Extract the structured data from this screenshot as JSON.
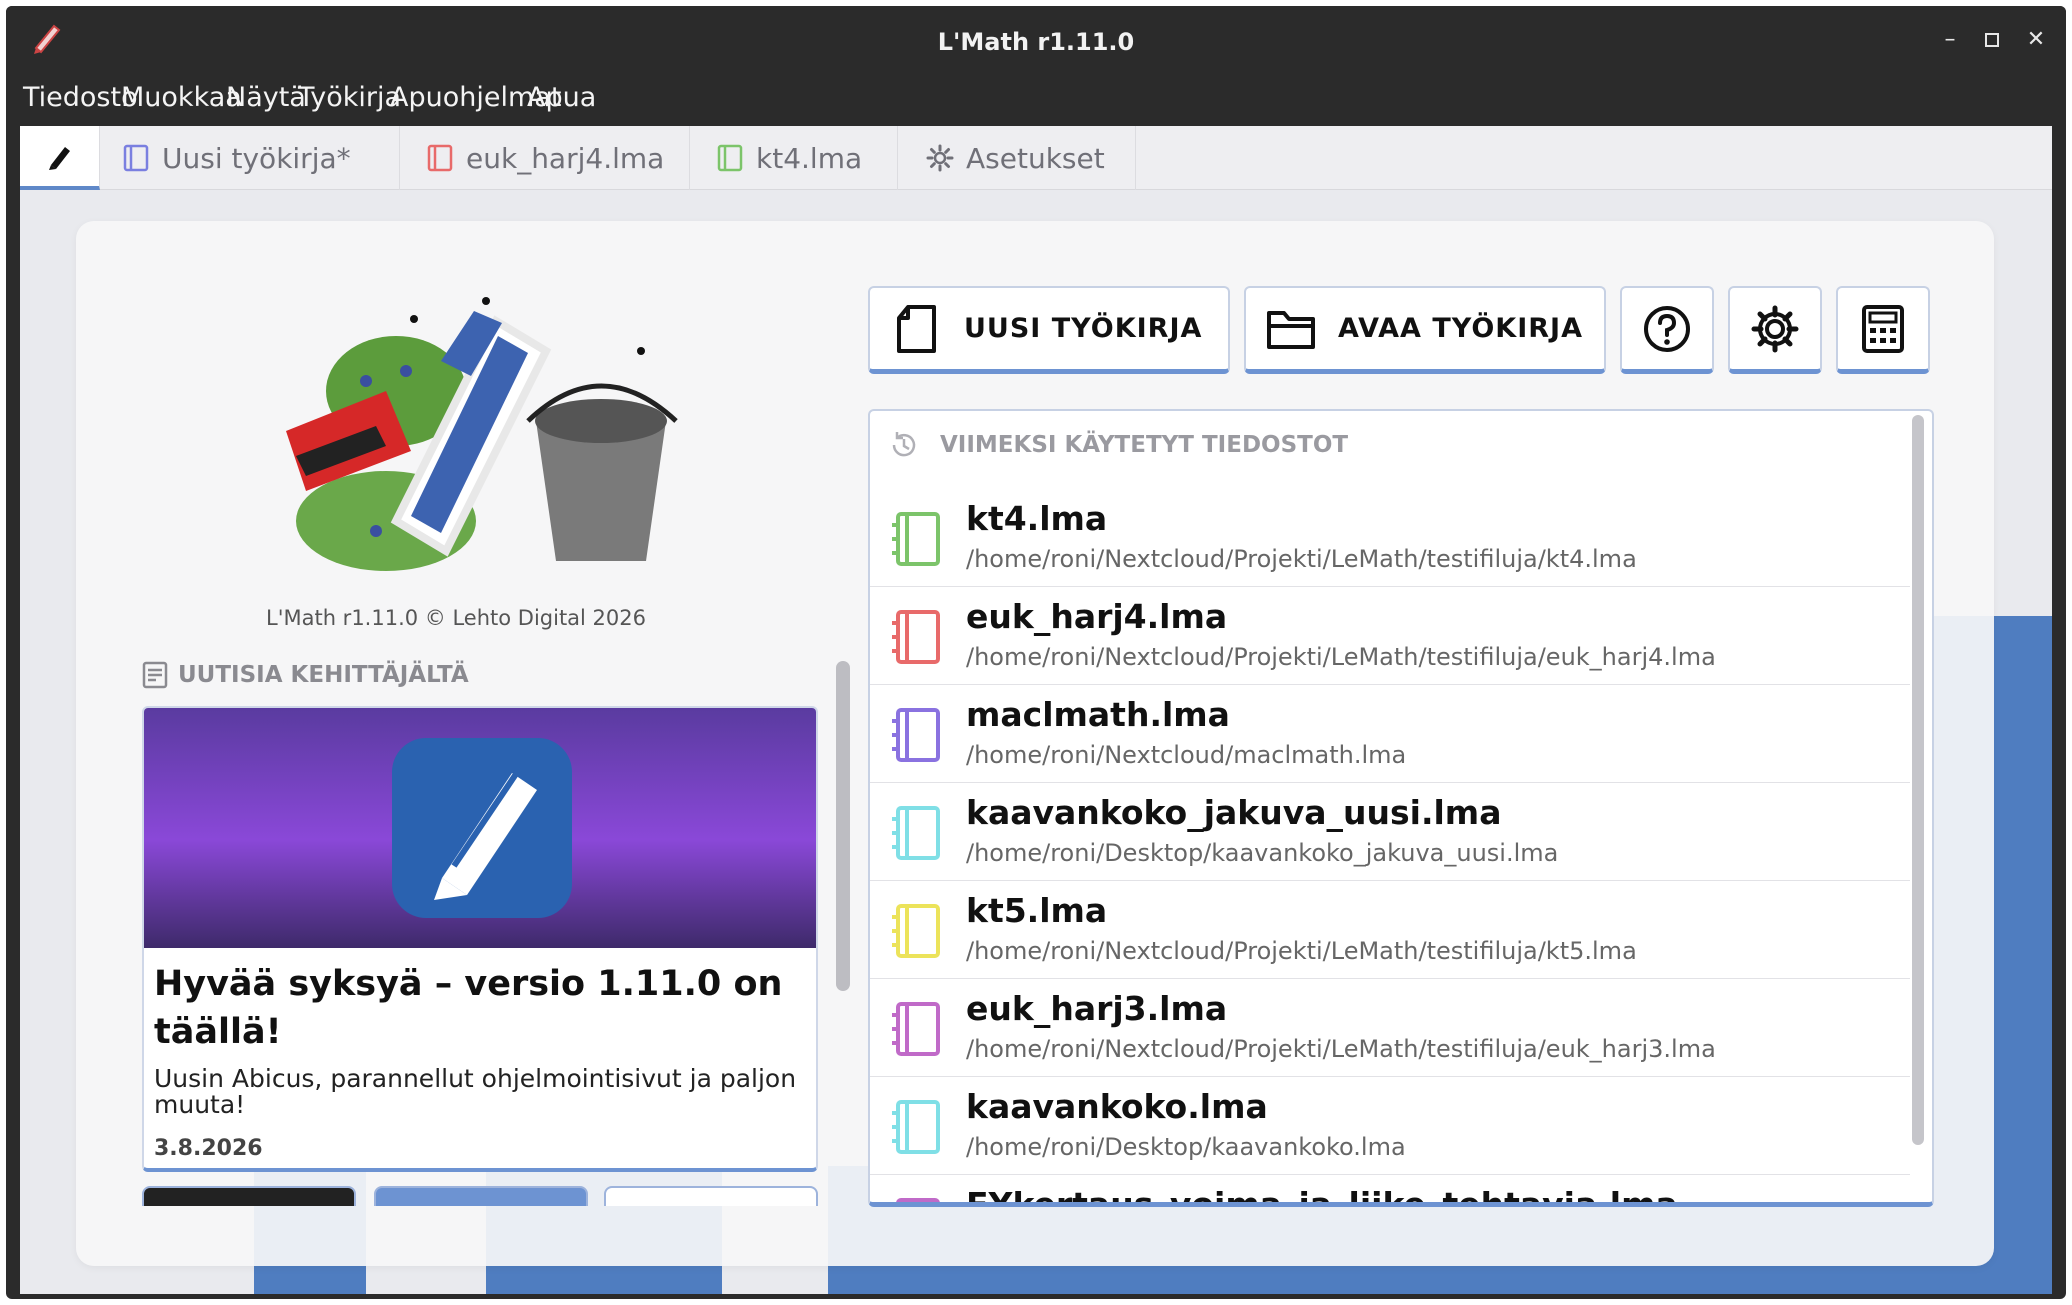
{
  "window": {
    "title": "L'Math r1.11.0",
    "controls": {
      "minimize": "–",
      "maximize": "▫",
      "close": "✕"
    }
  },
  "menu": [
    "Tiedosto",
    "Muokkaa",
    "Näytä",
    "Työkirja",
    "Apuohjelmat",
    "Apua"
  ],
  "tabs": [
    {
      "label": "Uusi työkirja*",
      "icon": "notebook-icon",
      "color": "#7a7fe0"
    },
    {
      "label": "euk_harj4.lma",
      "icon": "notebook-icon",
      "color": "#e86a6a"
    },
    {
      "label": "kt4.lma",
      "icon": "notebook-icon",
      "color": "#7cc46a"
    },
    {
      "label": "Asetukset",
      "icon": "gear-icon",
      "color": "#707078"
    }
  ],
  "home": {
    "copyright": "L'Math r1.11.0 © Lehto Digital 2026",
    "news": {
      "header": "UUTISIA KEHITTÄJÄLTÄ",
      "title": "Hyvää syksyä – versio 1.11.0 on täällä!",
      "description": "Uusin Abicus, parannellut ohjelmointisivut ja paljon muuta!",
      "date": "3.8.2026"
    },
    "buttons": {
      "new_workbook": "UUSI TYÖKIRJA",
      "open_workbook": "AVAA TYÖKIRJA"
    },
    "recent": {
      "header": "VIIMEKSI KÄYTETYT TIEDOSTOT",
      "items": [
        {
          "name": "kt4.lma",
          "path": "/home/roni/Nextcloud/Projekti/LeMath/testifiluja/kt4.lma",
          "color": "#7cc46a"
        },
        {
          "name": "euk_harj4.lma",
          "path": "/home/roni/Nextcloud/Projekti/LeMath/testifiluja/euk_harj4.lma",
          "color": "#e86a6a"
        },
        {
          "name": "maclmath.lma",
          "path": "/home/roni/Nextcloud/maclmath.lma",
          "color": "#8a72e0"
        },
        {
          "name": "kaavankoko_jakuva_uusi.lma",
          "path": "/home/roni/Desktop/kaavankoko_jakuva_uusi.lma",
          "color": "#7fdfe6"
        },
        {
          "name": "kt5.lma",
          "path": "/home/roni/Nextcloud/Projekti/LeMath/testifiluja/kt5.lma",
          "color": "#ece35a"
        },
        {
          "name": "euk_harj3.lma",
          "path": "/home/roni/Nextcloud/Projekti/LeMath/testifiluja/euk_harj3.lma",
          "color": "#c06ac8"
        },
        {
          "name": "kaavankoko.lma",
          "path": "/home/roni/Desktop/kaavankoko.lma",
          "color": "#7fdfe6"
        },
        {
          "name": "FYkertaus_voima_ja_liike_tehtavia.lma",
          "path": "",
          "color": "#c06ac8"
        }
      ]
    }
  }
}
